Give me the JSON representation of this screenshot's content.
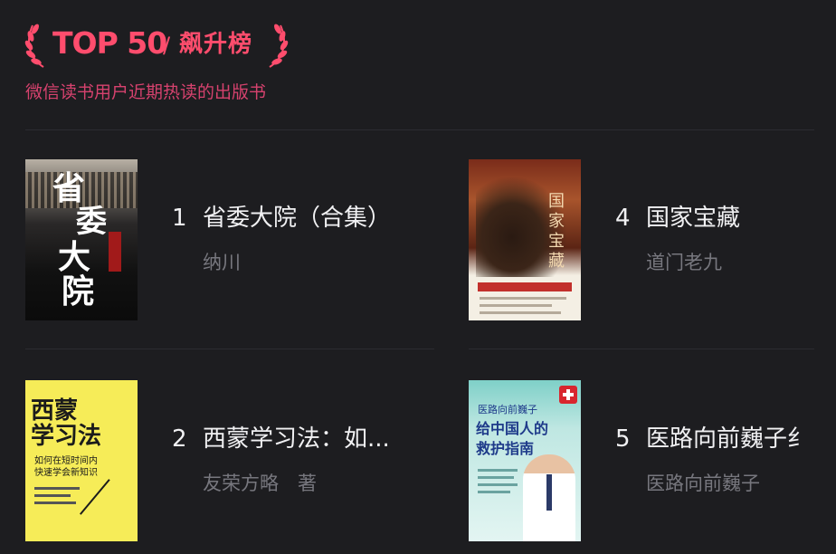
{
  "header": {
    "badge": "TOP 50",
    "separator": "/",
    "list_name": "飙升榜",
    "subtitle": "微信读书用户近期热读的出版书"
  },
  "books": [
    {
      "rank": "1",
      "title": "省委大院（合集）",
      "author": "纳川",
      "cover_text": [
        "省",
        "委",
        "大",
        "院"
      ]
    },
    {
      "rank": "4",
      "title": "国家宝藏",
      "author": "道门老九",
      "cover_text": "国家宝藏"
    },
    {
      "rank": "2",
      "title": "西蒙学习法：如...",
      "author": "友荣方略　著",
      "cover_text": [
        "西蒙",
        "学习法",
        "如何在短时间内",
        "快速学会新知识"
      ]
    },
    {
      "rank": "5",
      "title": "医路向前巍子纟",
      "author": "医路向前巍子",
      "cover_text": [
        "医路向前巍子",
        "给中国人的",
        "救护指南"
      ]
    }
  ],
  "colors": {
    "background": "#1d1d20",
    "accent": "#ff4d6d",
    "subtitle": "#d6426e",
    "title_text": "#f1f1f3",
    "author_text": "#77777e"
  },
  "icons": {
    "laurel": "laurel-icon"
  }
}
